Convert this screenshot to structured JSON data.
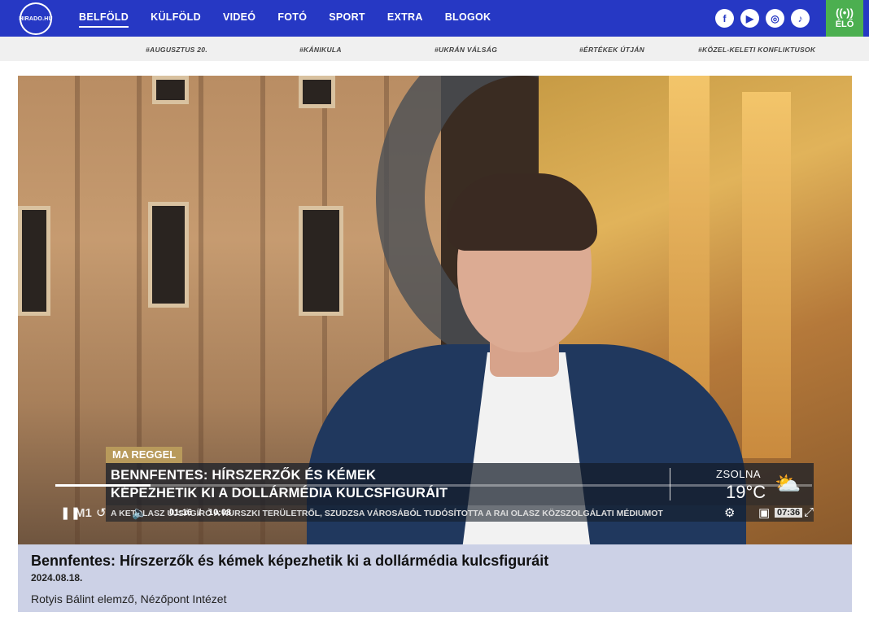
{
  "header": {
    "logo_text": "HIRADO.HU",
    "nav": [
      "BELFÖLD",
      "KÜLFÖLD",
      "VIDEÓ",
      "FOTÓ",
      "SPORT",
      "EXTRA",
      "BLOGOK"
    ],
    "active_nav": "BELFÖLD",
    "social_icons": [
      "facebook-icon",
      "youtube-icon",
      "instagram-icon",
      "tiktok-icon"
    ],
    "live_label": "ÉLŐ",
    "live_color": "#4caf50",
    "brand_color": "#2638c4"
  },
  "hashtags": [
    "#AUGUSZTUS 20.",
    "#KÁNIKULA",
    "#UKRÁN VÁLSÁG",
    "#ÉRTÉKEK ÚTJÁN",
    "#KÖZEL-KELETI KONFLIKTUSOK"
  ],
  "video": {
    "chyron_tag": "MA REGGEL",
    "chyron_line1": "BENNFENTES: HÍRSZERZŐK ÉS KÉMEK",
    "chyron_line2": "KÉPEZHETIK KI A DOLLÁRMÉDIA KULCSFIGURÁIT",
    "weather_city": "ZSOLNA",
    "weather_temp": "19°C",
    "ticker_text": "A KETOLASZ ÚJSÁGÍRÓ A KURSZKI TERÜLETRŐL, SZUDZSA VÁROSÁBÓL TUDÓSÍTOTTA A RAI OLASZ KÖZSZOLGÁLATI MÉDIUMOT",
    "channel": "M1",
    "current_time": "01:16",
    "time_separator": "/",
    "duration": "10:08",
    "clock": "07:36",
    "progress": 0.126
  },
  "caption": {
    "title": "Bennfentes: Hírszerzők és kémek képezhetik ki a dollármédia kulcsfiguráit",
    "date": "2024.08.18.",
    "description": "Rotyis Bálint elemző, Nézőpont Intézet"
  }
}
